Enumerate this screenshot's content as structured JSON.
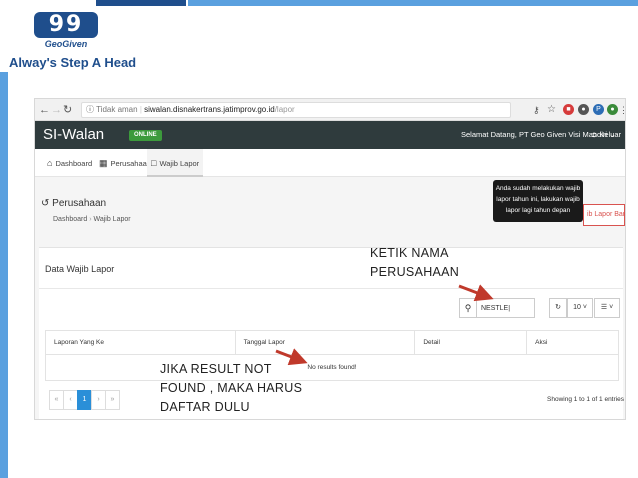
{
  "slide": {
    "logo_mark": "99",
    "logo_text": "GeoGiven",
    "tagline": "Alway's Step A Head",
    "colors": {
      "brand_dark": "#1f4e8c",
      "brand_light": "#5aa0df",
      "annotation_arrow": "#c0392b"
    }
  },
  "browser": {
    "url_security": "Tidak aman",
    "url_host": "siwalan.disnakertrans.jatimprov.go.id",
    "url_path": "/lapor",
    "nav_icons": [
      "back-icon",
      "forward-icon",
      "reload-icon",
      "info-icon"
    ]
  },
  "app": {
    "title": "SI-Walan",
    "status_badge": "ONLINE",
    "welcome": "Selamat Datang, PT Geo Given Visi Mandiri ⌄",
    "logout": "Keluar",
    "nav": [
      {
        "label": "Dashboard",
        "icon": "home-icon"
      },
      {
        "label": "Perusahaan",
        "icon": "building-icon"
      },
      {
        "label": "Wajib Lapor",
        "icon": "document-icon"
      }
    ],
    "page_title": "Perusahaan",
    "breadcrumb": [
      "Dashboard",
      "Wajib Lapor"
    ],
    "tooltip": "Anda sudah melakukan wajib lapor tahun ini, lakukan wajib lapor lagi tahun depan",
    "add_button": "ib Lapor Baru",
    "panel_title": "Data Wajib Lapor",
    "search_value": "NESTLE|",
    "page_size": "10",
    "table": {
      "columns": [
        "Laporan Yang Ke",
        "Tanggal Lapor",
        "Detail",
        "Aksi"
      ],
      "empty_message": "No results found!"
    },
    "pagination": {
      "buttons": [
        "«",
        "‹",
        "1",
        "›",
        "»"
      ],
      "current": "1",
      "showing": "Showing 1 to 1 of 1 entries"
    }
  },
  "annotations": {
    "ketik_line1": "KETIK NAMA",
    "ketik_line2": "PERUSAHAAN",
    "jika_line1": "JIKA RESULT NOT",
    "jika_line2": "FOUND , MAKA HARUS",
    "jika_line3": "DAFTAR DULU"
  }
}
